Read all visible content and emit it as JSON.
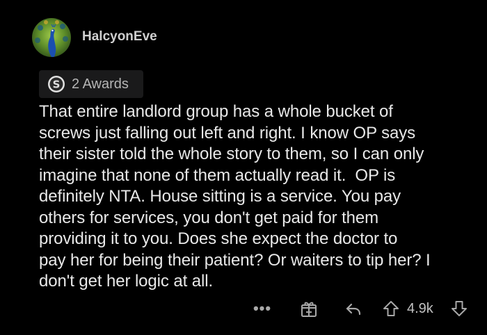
{
  "comment": {
    "author": "HalcyonEve",
    "awards_label": "2 Awards",
    "body": "That entire landlord group has a whole bucket of\nscrews just falling out left and right. I know OP says\ntheir sister told the whole story to them, so I can only\nimagine that none of them actually read it.  OP is\ndefinitely NTA. House sitting is a service. You pay\nothers for services, you don't get paid for them\nproviding it to you. Does she expect the doctor to\npay her for being their patient? Or waiters to tip her? I\ndon't get her logic at all.",
    "score": "4.9k",
    "more_label": "•••"
  },
  "icons": {
    "avatar": "peacock-avatar",
    "award": "silver-award-icon",
    "gift": "gift-icon",
    "reply": "reply-arrow-icon",
    "upvote": "upvote-arrow-icon",
    "downvote": "downvote-arrow-icon"
  },
  "colors": {
    "background": "#000000",
    "text": "#e8e8e8",
    "muted": "#a8a8a8",
    "award_chip": "#1a1a1b"
  }
}
